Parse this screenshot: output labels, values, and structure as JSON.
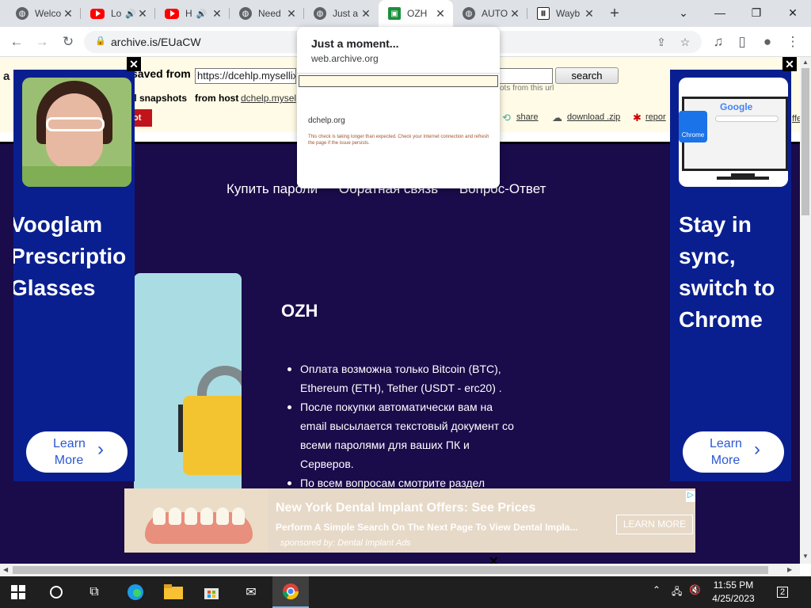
{
  "tabs": [
    {
      "title": "Welco",
      "favicon": "globe-icon"
    },
    {
      "title": "Lo",
      "favicon": "youtube-icon",
      "audio": true
    },
    {
      "title": "H",
      "favicon": "youtube-icon",
      "audio": true
    },
    {
      "title": "Need",
      "favicon": "globe-icon"
    },
    {
      "title": "Just a",
      "favicon": "loading-globe-icon"
    },
    {
      "title": "OZH",
      "favicon": "ozh-icon",
      "active": true
    },
    {
      "title": "AUTO",
      "favicon": "globe-icon"
    },
    {
      "title": "Wayb",
      "favicon": "wayback-icon"
    }
  ],
  "toolbar": {
    "url": "archive.is/EUaCW"
  },
  "archive_bar": {
    "saved_from_label": "saved from",
    "saved_url": "https://dcehlp.mysellix",
    "search_label": "search",
    "snapshots_label": "ll snapshots",
    "from_host_label": "from host",
    "host": "dchelp.mysel",
    "from_url_text": "ots from this url",
    "red_btn": "ot",
    "share": "share",
    "download": "download .zip",
    "report": "repor",
    "edge_text": "ffe",
    "edge_letter": "a"
  },
  "site": {
    "nav": [
      "Купить пароли",
      "Обратная связь",
      "Вопрос-Ответ"
    ],
    "product_title": "OZH",
    "bullets": [
      "Оплата возможна только Bitcoin (BTC), Ethereum (ETH), Tether (USDT - erc20) .",
      "После покупки автоматически вам на email высылается текстовый документ со всеми паролями для ваших ПК и Серверов.",
      "По всем вопросам смотрите раздел"
    ]
  },
  "left_ad": {
    "headline": "Vooglam\nPrescriptio\nGlasses",
    "button": "Learn\nMore"
  },
  "right_ad": {
    "headline": "Stay in\nsync,\nswitch to\nChrome",
    "button": "Learn\nMore"
  },
  "bottom_ad": {
    "title": "New York Dental Implant Offers: See Prices",
    "desc": "Perform A Simple Search On The Next Page To View Dental Impla...",
    "sponsor": "sponsored by: Dental Implant Ads",
    "button": "LEARN MORE"
  },
  "popup": {
    "title": "Just a moment...",
    "host": "web.archive.org",
    "thumb_host": "dchelp.org",
    "thumb_msg": "This check is taking longer than expected. Check your Internet connection and refresh the page if the issue persists."
  },
  "taskbar": {
    "time": "11:55 PM",
    "date": "4/25/2023",
    "notifications": "2"
  },
  "colors": {
    "site_bg": "#1a0b4b",
    "ad_blue": "#0a1f8f",
    "archive_bg": "#fffbe6"
  }
}
